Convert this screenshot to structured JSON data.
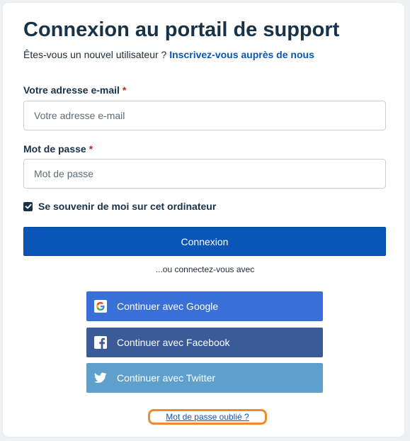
{
  "header": {
    "title": "Connexion au portail de support",
    "subtitle_text": "Êtes-vous un nouvel utilisateur ? ",
    "signup_link": "Inscrivez-vous auprès de nous"
  },
  "form": {
    "email": {
      "label": "Votre adresse e-mail",
      "required_mark": "*",
      "placeholder": "Votre adresse e-mail",
      "value": ""
    },
    "password": {
      "label": "Mot de passe",
      "required_mark": "*",
      "placeholder": "Mot de passe",
      "value": ""
    },
    "remember": {
      "label": "Se souvenir de moi sur cet ordinateur",
      "checked": true
    },
    "submit_label": "Connexion"
  },
  "social": {
    "divider_text": "...ou connectez-vous avec",
    "google": {
      "label": "Continuer avec Google",
      "color": "#3a6fd8",
      "icon": "google-icon"
    },
    "facebook": {
      "label": "Continuer avec Facebook",
      "color": "#3b5b98",
      "icon": "facebook-icon"
    },
    "twitter": {
      "label": "Continuer avec Twitter",
      "color": "#5e9fcb",
      "icon": "twitter-icon"
    }
  },
  "forgot_password": "Mot de passe oublié ?",
  "colors": {
    "primary": "#0a56b7",
    "title": "#183247",
    "required": "#c62828",
    "highlight": "#f08a2e"
  }
}
